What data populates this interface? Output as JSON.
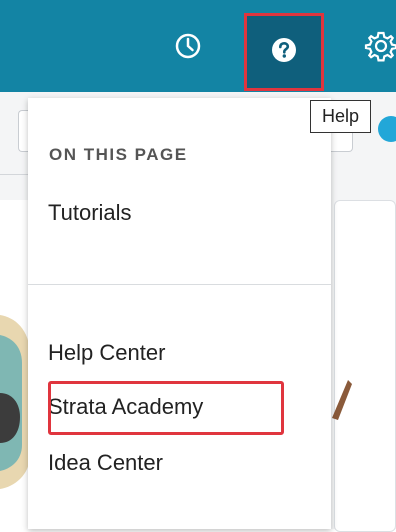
{
  "topbar": {
    "background": "#1384a4",
    "icons": {
      "history": "clock-icon",
      "help": "question-circle-icon",
      "settings": "gear-icon"
    },
    "active_background": "#0f5f7c"
  },
  "tooltip": {
    "text": "Help"
  },
  "dropdown": {
    "section_title": "ON THIS PAGE",
    "page_items": [
      "Tutorials"
    ],
    "resource_items": [
      "Help Center",
      "Strata Academy",
      "Idea Center"
    ]
  },
  "colors": {
    "highlight": "#e0353e",
    "accent_blue": "#22a7d8"
  }
}
